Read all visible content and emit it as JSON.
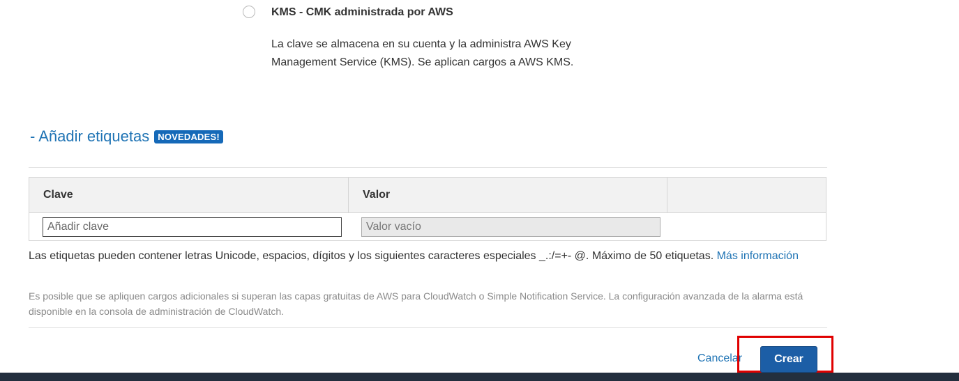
{
  "kms_option": {
    "title": "KMS - CMK administrada por AWS",
    "description": "La clave se almacena en su cuenta y la administra AWS Key Management Service (KMS). Se aplican cargos a AWS KMS.",
    "selected": false
  },
  "tags": {
    "toggle_label": "- Añadir etiquetas",
    "badge": "NOVEDADES!",
    "columns": {
      "key": "Clave",
      "value": "Valor",
      "extra": ""
    },
    "row": {
      "key_placeholder": "Añadir clave",
      "value_placeholder": "Valor vacío"
    },
    "help_text": "Las etiquetas pueden contener letras Unicode, espacios, dígitos y los siguientes caracteres especiales _.:/=+- @. Máximo de 50 etiquetas.",
    "help_link": "Más información"
  },
  "note": "Es posible que se apliquen cargos adicionales si superan las capas gratuitas de AWS para CloudWatch o Simple Notification Service. La configuración avanzada de la alarma está disponible en la consola de administración de CloudWatch.",
  "actions": {
    "cancel_label": "Cancelar",
    "create_label": "Crear"
  },
  "colors": {
    "link": "#1e73b4",
    "primary_button": "#1c5ea6",
    "badge": "#1569b8",
    "highlight": "#e00000",
    "footer": "#232f3e"
  }
}
